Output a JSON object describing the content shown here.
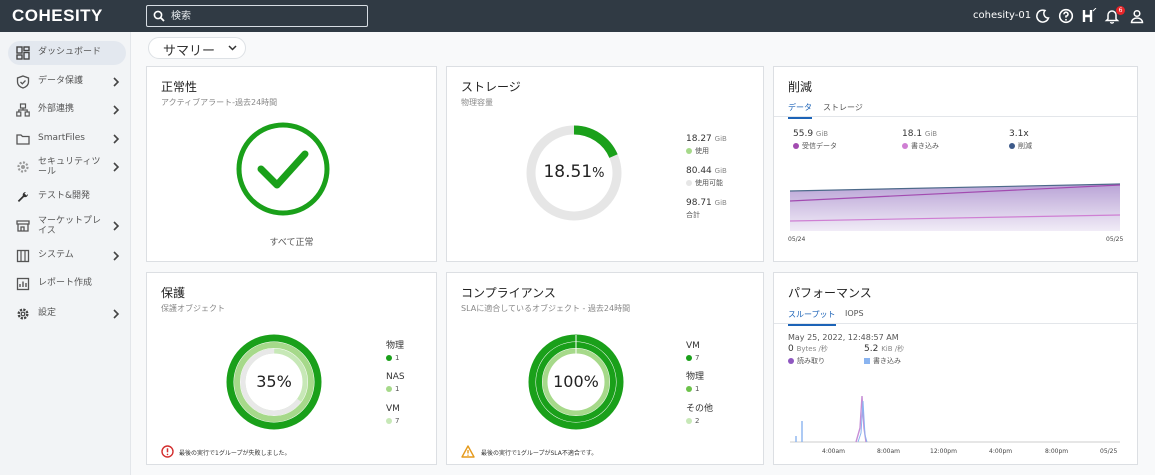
{
  "header": {
    "logo": "COHESITY",
    "search_placeholder": "検索",
    "cluster_name": "cohesity-01",
    "notification_count": "6"
  },
  "sidebar": {
    "items": [
      {
        "label": "ダッシュボード",
        "active": true
      },
      {
        "label": "データ保護"
      },
      {
        "label": "外部連携"
      },
      {
        "label": "SmartFiles"
      },
      {
        "label": "セキュリティツール"
      },
      {
        "label": "テスト&開発"
      },
      {
        "label": "マーケットプレイス"
      },
      {
        "label": "システム"
      },
      {
        "label": "レポート作成"
      },
      {
        "label": "設定"
      }
    ]
  },
  "summary_dropdown": "サマリー",
  "health": {
    "title": "正常性",
    "subtitle": "アクティブアラート-過去24時間",
    "status": "すべて正常"
  },
  "storage": {
    "title": "ストレージ",
    "subtitle": "物理容量",
    "percent": "18.51",
    "percent_value": 18.51,
    "used_value": "18.27",
    "used_unit": "GiB",
    "used_label": "使用",
    "available_value": "80.44",
    "available_unit": "GiB",
    "available_label": "使用可能",
    "total_value": "98.71",
    "total_unit": "GiB",
    "total_label": "合計"
  },
  "reduction": {
    "title": "削減",
    "tab_data": "データ",
    "tab_storage": "ストレージ",
    "received_value": "55.9",
    "received_unit": "GiB",
    "received_label": "受信データ",
    "written_value": "18.1",
    "written_unit": "GiB",
    "written_label": "書き込み",
    "ratio_value": "3.1x",
    "ratio_label": "削減",
    "x_start": "05/24",
    "x_end": "05/25"
  },
  "protection": {
    "title": "保護",
    "subtitle": "保護オブジェクト",
    "percent": "35%",
    "physical_label": "物理",
    "physical_count": "1",
    "nas_label": "NAS",
    "nas_count": "1",
    "vm_label": "VM",
    "vm_count": "7",
    "footnote": "最後の実行で1グループが失敗しました。"
  },
  "compliance": {
    "title": "コンプライアンス",
    "subtitle": "SLAに適合しているオブジェクト - 過去24時間",
    "percent": "100%",
    "vm_label": "VM",
    "vm_count": "7",
    "physical_label": "物理",
    "physical_count": "1",
    "other_label": "その他",
    "other_count": "2",
    "footnote": "最後の実行で1グループがSLA不適合です。"
  },
  "performance": {
    "title": "パフォーマンス",
    "tab_throughput": "スループット",
    "tab_iops": "IOPS",
    "timestamp": "May 25, 2022, 12:48:57 AM",
    "read_value": "0",
    "read_unit": "Bytes /秒",
    "read_label": "読み取り",
    "write_value": "5.2",
    "write_unit": "KiB /秒",
    "write_label": "書き込み",
    "x_ticks": [
      "4:00am",
      "8:00am",
      "12:00pm",
      "4:00pm",
      "8:00pm",
      "05/25"
    ]
  },
  "colors": {
    "accent_green": "#1aa01a",
    "light_green": "#a6d98a",
    "brand_blue": "#1c63b7",
    "topbar": "#303a44"
  }
}
